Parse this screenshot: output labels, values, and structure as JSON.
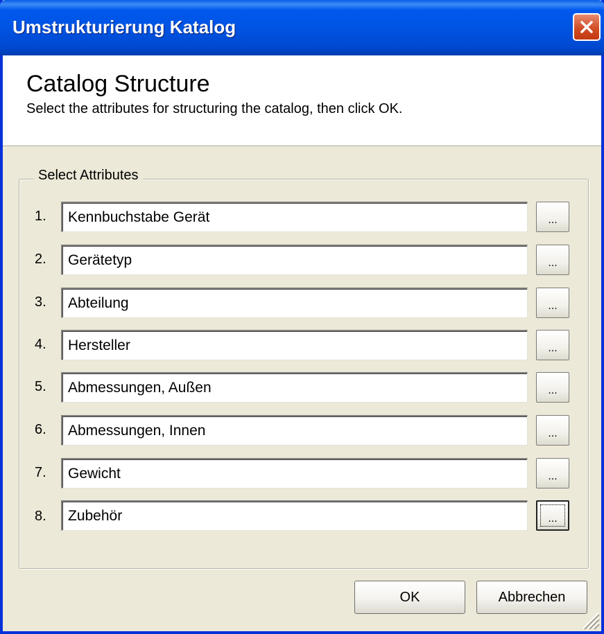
{
  "window": {
    "title": "Umstrukturierung Katalog"
  },
  "header": {
    "title": "Catalog Structure",
    "description": "Select the attributes for structuring the catalog, then click OK."
  },
  "attributes_group": {
    "legend": "Select Attributes",
    "rows": [
      {
        "number": "1.",
        "value": "Kennbuchstabe Gerät",
        "button_label": "..."
      },
      {
        "number": "2.",
        "value": "Gerätetyp",
        "button_label": "..."
      },
      {
        "number": "3.",
        "value": "Abteilung",
        "button_label": "..."
      },
      {
        "number": "4.",
        "value": "Hersteller",
        "button_label": "..."
      },
      {
        "number": "5.",
        "value": "Abmessungen, Außen",
        "button_label": "..."
      },
      {
        "number": "6.",
        "value": "Abmessungen, Innen",
        "button_label": "..."
      },
      {
        "number": "7.",
        "value": "Gewicht",
        "button_label": "..."
      },
      {
        "number": "8.",
        "value": "Zubehör",
        "button_label": "..."
      }
    ]
  },
  "footer": {
    "ok_label": "OK",
    "cancel_label": "Abbrechen"
  },
  "icons": {
    "close": "close-icon",
    "resize": "resize-grip-icon"
  },
  "colors": {
    "titlebar": "#0054e3",
    "close_button": "#d04a22",
    "dialog_background": "#ece9d8"
  }
}
